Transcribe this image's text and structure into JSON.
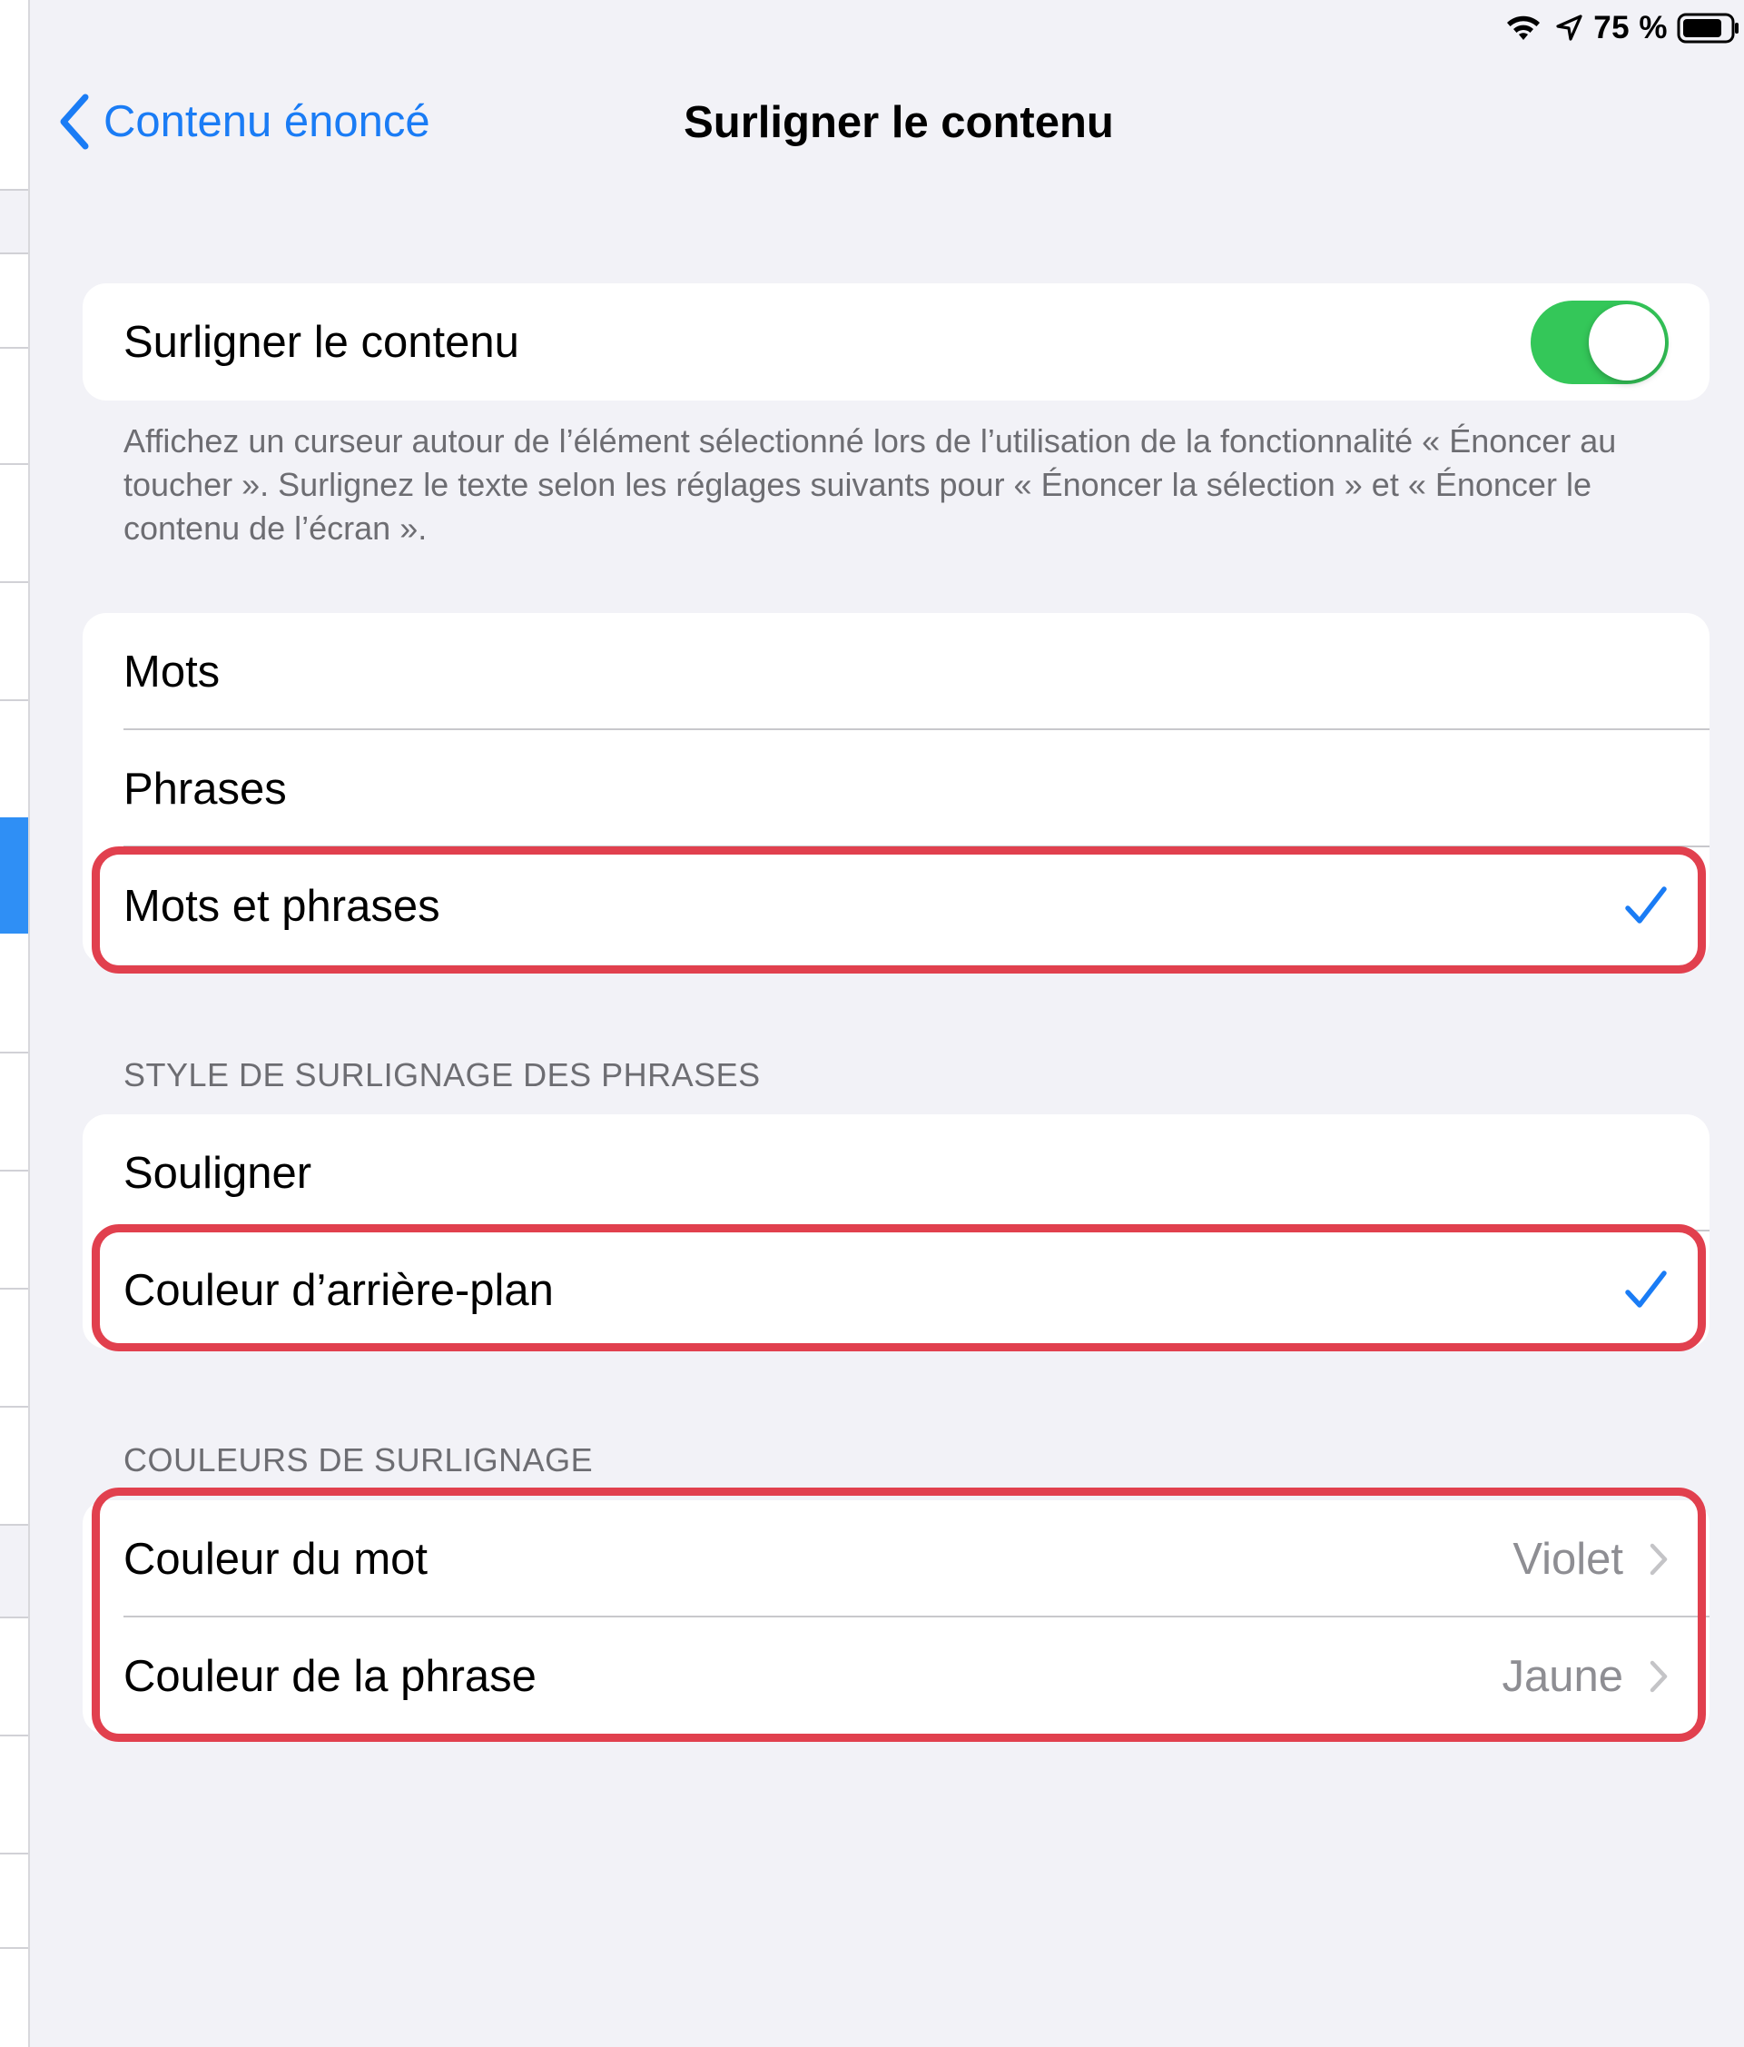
{
  "status_bar": {
    "battery_percent": "75 %",
    "icons": [
      "wifi-icon",
      "location-arrow-icon",
      "battery-icon"
    ]
  },
  "nav": {
    "back_label": "Contenu énoncé",
    "title": "Surligner le contenu"
  },
  "highlight_toggle": {
    "label": "Surligner le contenu",
    "on": true,
    "color": "#34c759"
  },
  "footer_text": "Affichez un curseur autour de l’élément sélectionné lors de l’utilisation de la fonctionnalité « Énoncer au toucher ». Surlignez le texte selon les réglages suivants pour « Énoncer la sélection » et « Énoncer le contenu de l’écran ».",
  "highlight_mode": {
    "options": [
      "Mots",
      "Phrases",
      "Mots et phrases"
    ],
    "selected": "Mots et phrases"
  },
  "sentence_style": {
    "header": "STYLE DE SURLIGNAGE DES PHRASES",
    "options": [
      "Souligner",
      "Couleur d’arrière-plan"
    ],
    "selected": "Couleur d’arrière-plan"
  },
  "highlight_colors": {
    "header": "COULEURS DE SURLIGNAGE",
    "items": [
      {
        "label": "Couleur du mot",
        "value": "Violet"
      },
      {
        "label": "Couleur de la phrase",
        "value": "Jaune"
      }
    ]
  },
  "colors": {
    "accent": "#1a7cf5",
    "annotation_red": "#e1404e",
    "background": "#f2f2f7"
  }
}
